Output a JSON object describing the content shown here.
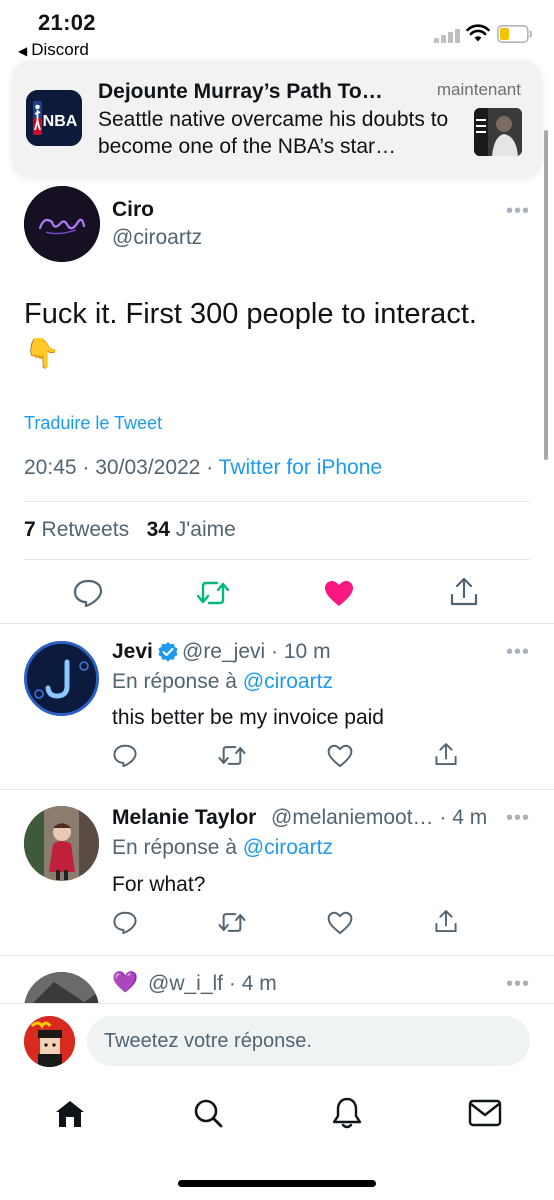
{
  "status_bar": {
    "time": "21:02",
    "back_label": "Discord"
  },
  "notification": {
    "app_icon": "nba-logo",
    "app_logo_text": "NBA",
    "title": "Dejounte Murray’s Path To…",
    "time": "maintenant",
    "body": "Seattle native overcame his doubts to become one of the NBA’s star…"
  },
  "tweet": {
    "name": "Ciro",
    "handle": "@ciroartz",
    "text": "Fuck it. First 300 people to interact.",
    "emoji": "👇",
    "translate_label": "Traduire le Tweet",
    "time": "20:45",
    "date": "30/03/2022",
    "source": "Twitter for iPhone",
    "retweets_count": "7",
    "retweets_label": "Retweets",
    "likes_count": "34",
    "likes_label": "J'aime",
    "liked": true,
    "colors": {
      "retweet": "#00ba7c",
      "like": "#f91880",
      "link": "#1d9bf0"
    }
  },
  "replies": [
    {
      "name": "Jevi",
      "verified": true,
      "handle": "@re_jevi",
      "age": "10 m",
      "reply_prefix": "En réponse à",
      "reply_to": "@ciroartz",
      "text": "this better be my invoice paid"
    },
    {
      "name": "Melanie Taylor",
      "handle": "@melaniemoot…",
      "age": "4 m",
      "reply_prefix": "En réponse à",
      "reply_to": "@ciroartz",
      "text": "For what?"
    },
    {
      "name_emoji": "💜",
      "handle": "@w_i_lf",
      "age": "4 m"
    }
  ],
  "compose": {
    "placeholder": "Tweetez votre réponse."
  },
  "tabbar": {
    "items": [
      "home-icon",
      "search-icon",
      "bell-icon",
      "mail-icon"
    ]
  },
  "separator": "·"
}
